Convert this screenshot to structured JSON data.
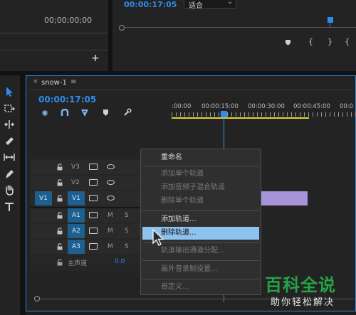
{
  "source_monitor": {
    "timecode": "00;00;00;00"
  },
  "program_monitor": {
    "timecode": "00:00:17:05",
    "fit_select": "适合",
    "fit_arrow": "⌄"
  },
  "timeline": {
    "tab_title": "snow-1",
    "tab_menu": "≡",
    "timecode": "00:00:17:05",
    "ruler_labels": [
      ":00:00",
      "00:00:15:00",
      "00:00:30:00",
      "00:00:45:00",
      "00:0"
    ],
    "video_tracks": [
      {
        "name": "V3",
        "source": ""
      },
      {
        "name": "V2",
        "source": ""
      },
      {
        "name": "V1",
        "source": "V1"
      }
    ],
    "audio_tracks": [
      {
        "name": "A1",
        "mute": "M",
        "solo": "S"
      },
      {
        "name": "A2",
        "mute": "M",
        "solo": "S"
      },
      {
        "name": "A3",
        "mute": "M",
        "solo": "S"
      }
    ],
    "master": {
      "label": "主声道",
      "value": "0.0"
    }
  },
  "context_menu": {
    "items": [
      {
        "label": "重命名",
        "enabled": true
      },
      {
        "label": "添加单个轨道",
        "enabled": false
      },
      {
        "label": "添加音频子混合轨道",
        "enabled": false
      },
      {
        "label": "删除单个轨道",
        "enabled": false
      },
      {
        "label": "添加轨道...",
        "enabled": true
      },
      {
        "label": "删除轨道...",
        "enabled": true,
        "highlighted": true
      },
      {
        "label": "轨道输出通道分配...",
        "enabled": false
      },
      {
        "label": "画外音录制设置...",
        "enabled": false
      },
      {
        "label": "自定义...",
        "enabled": false
      }
    ]
  },
  "watermark": {
    "title": "百科全说",
    "subtitle": "助你轻松解决"
  },
  "colors": {
    "accent_blue": "#2d8ceb",
    "menu_highlight": "#8fc3ef",
    "clip_purple": "#a592d8",
    "work_area_yellow": "#e0d23a",
    "watermark_green": "#27a346"
  },
  "icons": [
    "plus-icon",
    "marker-icon",
    "bracket-in-icon",
    "bracket-out-icon",
    "selection-tool-icon",
    "track-select-icon",
    "ripple-edit-icon",
    "razor-icon",
    "slip-icon",
    "pen-icon",
    "hand-icon",
    "type-icon",
    "lock-icon",
    "eye-icon",
    "wrench-icon",
    "snap-icon",
    "cursor-arrow-icon"
  ]
}
